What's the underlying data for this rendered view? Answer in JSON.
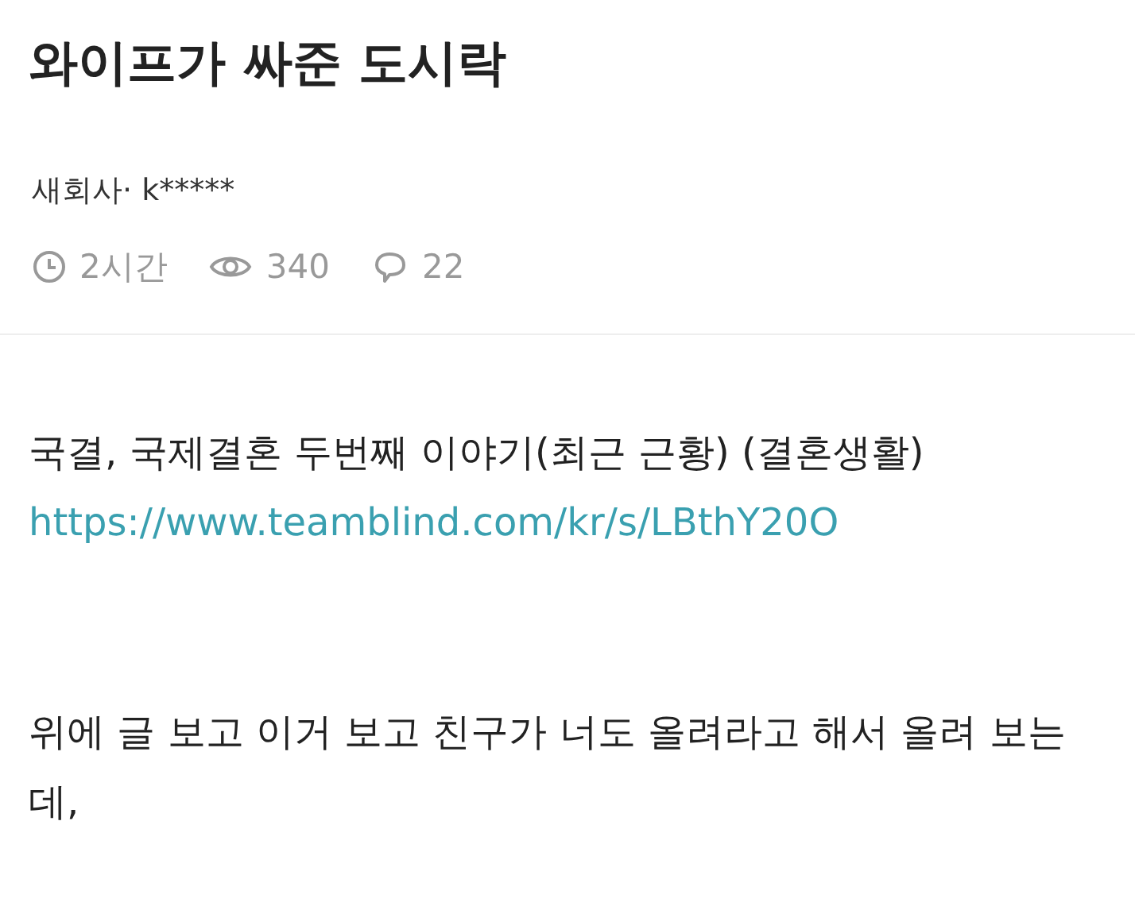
{
  "post": {
    "title": "와이프가 싸준 도시락",
    "author": "새회사· k*****",
    "stats": [
      {
        "kind": "time",
        "text": "2시간"
      },
      {
        "kind": "views",
        "text": "340"
      },
      {
        "kind": "comments",
        "text": "22"
      }
    ],
    "body": [
      {
        "kind": "text",
        "text": "국결, 국제결혼 두번째 이야기(최근 근황) (결혼생활)"
      },
      {
        "kind": "link",
        "text": "https://www.teamblind.com/kr/s/LBthY20O"
      },
      {
        "kind": "spacer"
      },
      {
        "kind": "text",
        "text": "위에 글 보고 이거 보고 친구가 너도 올려라고 해서 올려 보는데,"
      }
    ]
  }
}
